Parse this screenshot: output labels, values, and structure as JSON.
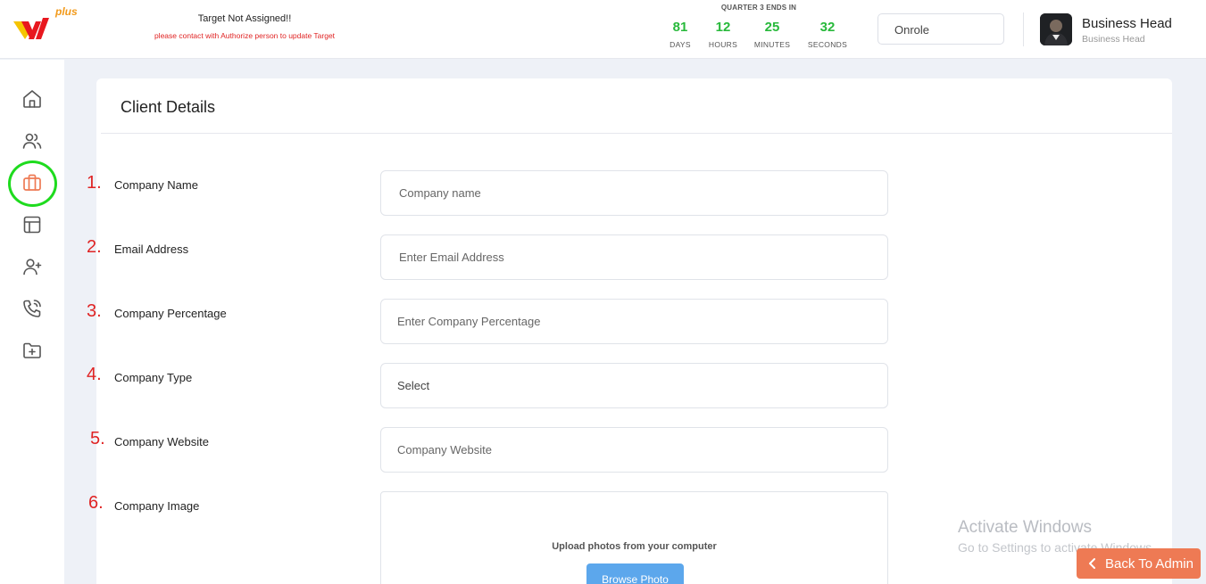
{
  "header": {
    "logo_text": "plus",
    "target_title": "Target Not Assigned!!",
    "target_note": "please contact with Authorize person to update Target",
    "countdown": {
      "title": "QUARTER 3 ENDS IN",
      "days": "81",
      "days_label": "DAYS",
      "hours": "12",
      "hours_label": "HOURS",
      "minutes": "25",
      "minutes_label": "MINUTES",
      "seconds": "32",
      "seconds_label": "SECONDS"
    },
    "role_select": "Onrole",
    "user": {
      "name": "Business Head",
      "role": "Business Head"
    }
  },
  "sidebar": {
    "items": [
      {
        "icon": "home-icon"
      },
      {
        "icon": "users-icon"
      },
      {
        "icon": "briefcase-icon",
        "active": true
      },
      {
        "icon": "layout-icon"
      },
      {
        "icon": "user-plus-icon"
      },
      {
        "icon": "phone-call-icon"
      },
      {
        "icon": "folder-plus-icon"
      }
    ]
  },
  "form": {
    "title": "Client Details",
    "fields": [
      {
        "number": "1.",
        "label": "Company Name",
        "placeholder": "Company name"
      },
      {
        "number": "2.",
        "label": "Email Address",
        "placeholder": "Enter Email Address"
      },
      {
        "number": "3.",
        "label": "Company Percentage",
        "placeholder": "Enter Company Percentage"
      },
      {
        "number": "4.",
        "label": "Company Type",
        "value": "Select"
      },
      {
        "number": "5.",
        "label": "Company Website",
        "placeholder": "Company Website"
      },
      {
        "number": "6.",
        "label": "Company Image"
      }
    ],
    "upload_text": "Upload photos from your computer",
    "browse_button": "Browse Photo"
  },
  "watermark": {
    "line1": "Activate Windows",
    "line2": "Go to Settings to activate Windows."
  },
  "back_button": "Back To Admin",
  "colors": {
    "accent": "#ee7a54",
    "countdown": "#28b93b",
    "annotation": "#e02424",
    "highlight": "#1edb1e",
    "browse": "#5ca7ec"
  }
}
